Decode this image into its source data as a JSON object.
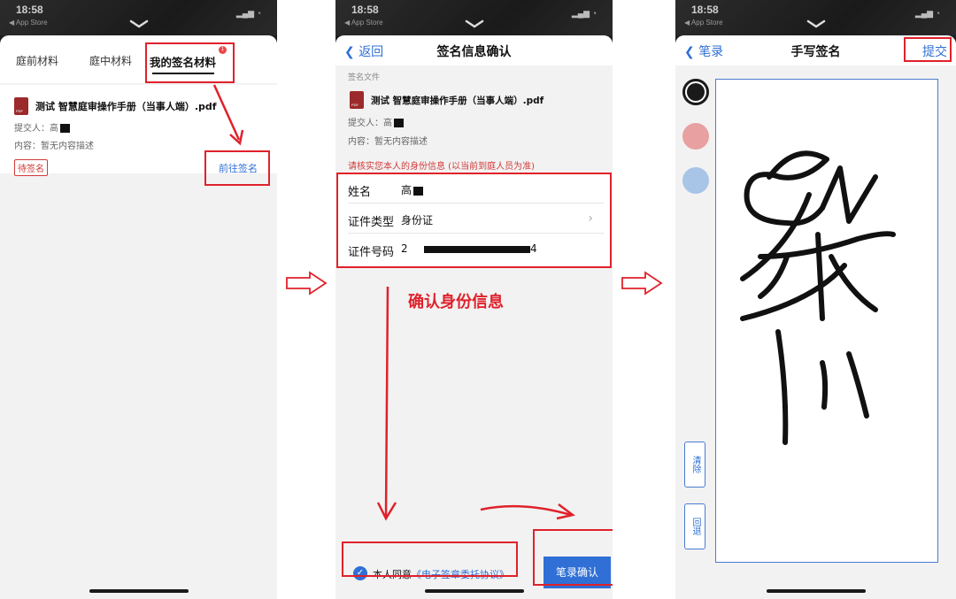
{
  "status": {
    "time": "18:58",
    "back_app": "◀ App Store"
  },
  "screen1": {
    "tabs": [
      "庭前材料",
      "庭中材料",
      "我的签名材料"
    ],
    "badge": "1",
    "file_name": "测试 智慧庭审操作手册（当事人端）.pdf",
    "submitter_label": "提交人：高",
    "content_label": "内容：暂无内容描述",
    "status_chip": "待签名",
    "go_sign": "前往签名"
  },
  "screen2": {
    "back": "返回",
    "title": "签名信息确认",
    "section_label": "签名文件",
    "file_name": "测试 智慧庭审操作手册（当事人端）.pdf",
    "submitter_label": "提交人：高",
    "content_label": "内容：暂无内容描述",
    "hint": "请核实您本人的身份信息 (以当前到庭人员为准)",
    "rows": [
      {
        "key": "姓名",
        "value": "高"
      },
      {
        "key": "证件类型",
        "value": "身份证"
      },
      {
        "key": "证件号码",
        "value": "2",
        "value_tail": "4"
      }
    ],
    "annotation": "确认身份信息",
    "agree_prefix": "本人同意",
    "agree_link": "《电子签章委托协议》",
    "confirm_btn": "笔录确认"
  },
  "screen3": {
    "back": "笔录",
    "title": "手写签名",
    "submit": "提交",
    "clear_btn": "清除",
    "undo_btn": "回退",
    "colors": [
      "#1a1a1a",
      "#e8a0a0",
      "#a8c4e6"
    ]
  },
  "colors": {
    "accent_red": "#e0212b",
    "link_blue": "#2f6fd6"
  }
}
